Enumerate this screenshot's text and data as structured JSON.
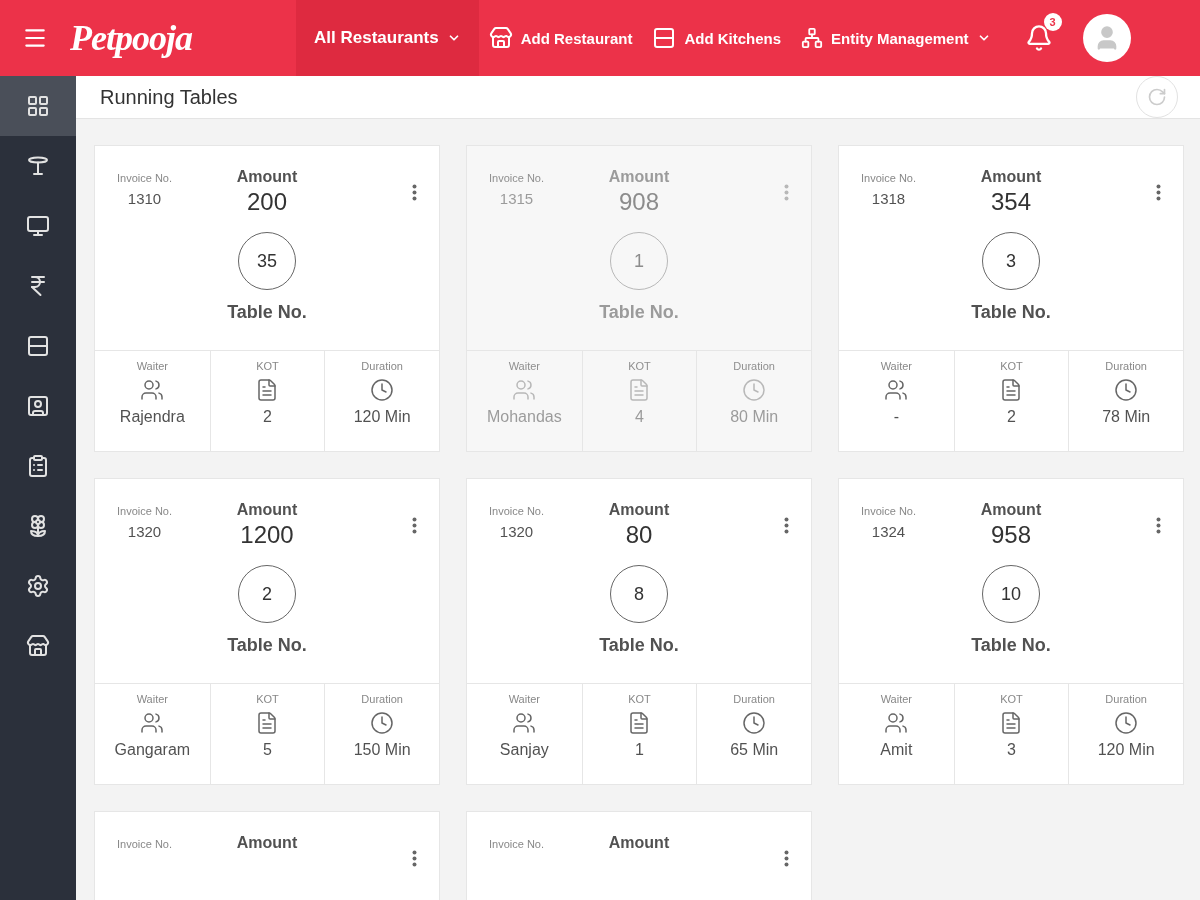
{
  "header": {
    "logo": "Petpooja",
    "nav": [
      {
        "kind": "restaurants",
        "label": "All Restaurants",
        "selected": true
      },
      {
        "kind": "add-restaurant",
        "label": "Add Restaurant",
        "selected": false
      },
      {
        "kind": "add-kitchens",
        "label": "Add Kitchens",
        "selected": false
      },
      {
        "kind": "entity",
        "label": "Entity Management",
        "selected": false
      }
    ],
    "notifications": "3"
  },
  "sidebar": {
    "items": [
      {
        "kind": "dashboard",
        "selected": true
      },
      {
        "kind": "table",
        "selected": false
      },
      {
        "kind": "monitor",
        "selected": false
      },
      {
        "kind": "rupee",
        "selected": false
      },
      {
        "kind": "rows",
        "selected": false
      },
      {
        "kind": "user-screen",
        "selected": false
      },
      {
        "kind": "report",
        "selected": false
      },
      {
        "kind": "flower",
        "selected": false
      },
      {
        "kind": "settings",
        "selected": false
      },
      {
        "kind": "store",
        "selected": false
      }
    ]
  },
  "page": {
    "title": "Running Tables"
  },
  "cards": [
    {
      "faded": false,
      "invoice_label": "Invoice No.",
      "invoice": "1310",
      "amount_label": "Amount",
      "amount": "200",
      "table": "35",
      "table_label": "Table No.",
      "waiter_label": "Waiter",
      "waiter": "Rajendra",
      "kot_label": "KOT",
      "kot": "2",
      "duration_label": "Duration",
      "duration": "120 Min"
    },
    {
      "faded": true,
      "invoice_label": "Invoice No.",
      "invoice": "1315",
      "amount_label": "Amount",
      "amount": "908",
      "table": "1",
      "table_label": "Table No.",
      "waiter_label": "Waiter",
      "waiter": "Mohandas",
      "kot_label": "KOT",
      "kot": "4",
      "duration_label": "Duration",
      "duration": "80 Min"
    },
    {
      "faded": false,
      "invoice_label": "Invoice No.",
      "invoice": "1318",
      "amount_label": "Amount",
      "amount": "354",
      "table": "3",
      "table_label": "Table No.",
      "waiter_label": "Waiter",
      "waiter": "-",
      "kot_label": "KOT",
      "kot": "2",
      "duration_label": "Duration",
      "duration": "78 Min"
    },
    {
      "faded": false,
      "invoice_label": "Invoice No.",
      "invoice": "1320",
      "amount_label": "Amount",
      "amount": "1200",
      "table": "2",
      "table_label": "Table No.",
      "waiter_label": "Waiter",
      "waiter": "Gangaram",
      "kot_label": "KOT",
      "kot": "5",
      "duration_label": "Duration",
      "duration": "150 Min"
    },
    {
      "faded": false,
      "invoice_label": "Invoice No.",
      "invoice": "1320",
      "amount_label": "Amount",
      "amount": "80",
      "table": "8",
      "table_label": "Table No.",
      "waiter_label": "Waiter",
      "waiter": "Sanjay",
      "kot_label": "KOT",
      "kot": "1",
      "duration_label": "Duration",
      "duration": "65 Min"
    },
    {
      "faded": false,
      "invoice_label": "Invoice No.",
      "invoice": "1324",
      "amount_label": "Amount",
      "amount": "958",
      "table": "10",
      "table_label": "Table No.",
      "waiter_label": "Waiter",
      "waiter": "Amit",
      "kot_label": "KOT",
      "kot": "3",
      "duration_label": "Duration",
      "duration": "120 Min"
    },
    {
      "faded": false,
      "invoice_label": "Invoice No.",
      "amount_label": "Amount"
    },
    {
      "faded": false,
      "invoice_label": "Invoice No.",
      "amount_label": "Amount"
    }
  ]
}
